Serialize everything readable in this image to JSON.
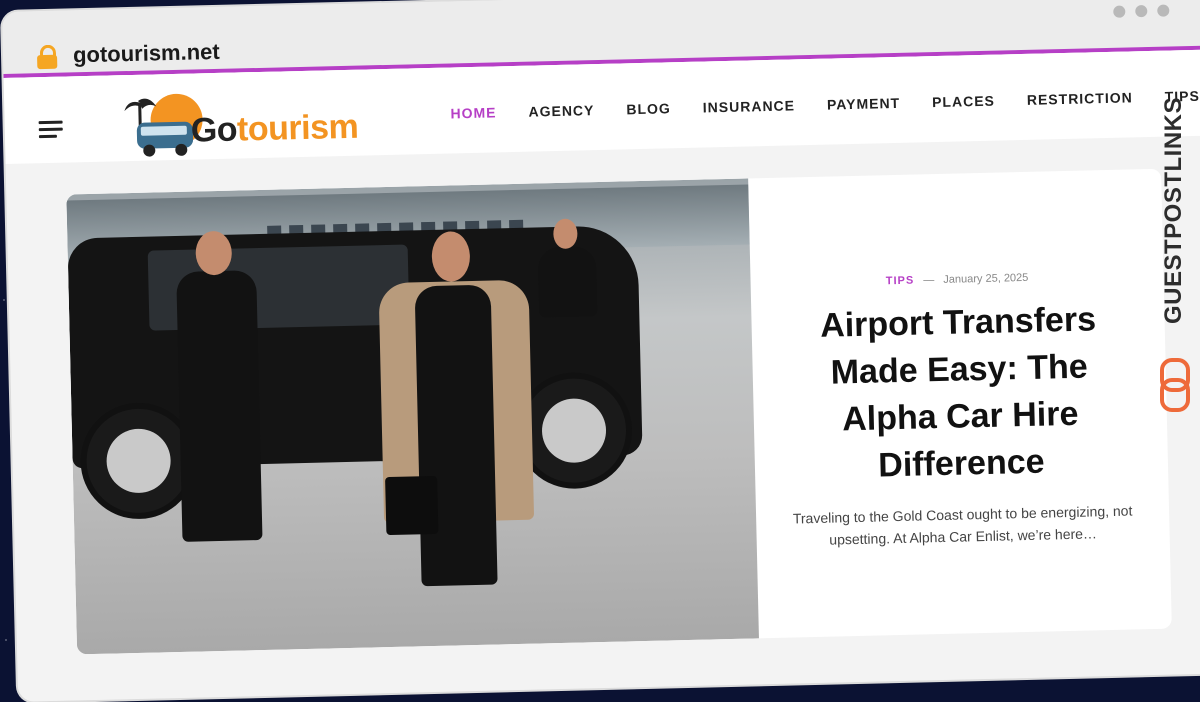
{
  "browser": {
    "url": "gotourism.net"
  },
  "site": {
    "logo_text_dark": "Go",
    "logo_text_orange": "tourism"
  },
  "nav": {
    "items": [
      "HOME",
      "AGENCY",
      "BLOG",
      "INSURANCE",
      "PAYMENT",
      "PLACES",
      "RESTRICTION",
      "TIPS"
    ],
    "active": "HOME"
  },
  "featured": {
    "category": "TIPS",
    "separator": "—",
    "date": "January 25, 2025",
    "title": "Airport Transfers Made Easy: The Alpha Car Hire Difference",
    "excerpt": "Traveling to the Gold Coast ought to be energizing, not upsetting. At Alpha Car Enlist, we’re here…"
  },
  "overlay_badge": {
    "text": "GUESTPOSTLINKS"
  },
  "colors": {
    "accent": "#b63fc6",
    "logo_orange": "#f39422",
    "lock": "#f5a623",
    "badge_icon": "#ee6a3a"
  }
}
